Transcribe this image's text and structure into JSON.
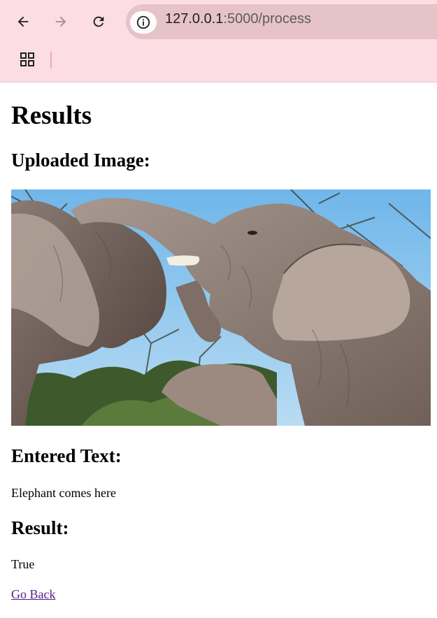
{
  "browser": {
    "url_host": "127.0.0.1",
    "url_rest": ":5000/process"
  },
  "page": {
    "title": "Results",
    "uploaded_heading": "Uploaded Image:",
    "entered_heading": "Entered Text:",
    "entered_text": "Elephant comes here",
    "result_heading": "Result:",
    "result_value": "True",
    "back_link": "Go Back"
  },
  "icons": {
    "back": "arrow-left-icon",
    "forward": "arrow-right-icon",
    "reload": "reload-icon",
    "info": "info-icon",
    "apps": "apps-grid-icon"
  },
  "colors": {
    "chrome_bg": "#fcdde3",
    "url_bar": "#e6c3c8",
    "link_visited": "#551a8b"
  }
}
